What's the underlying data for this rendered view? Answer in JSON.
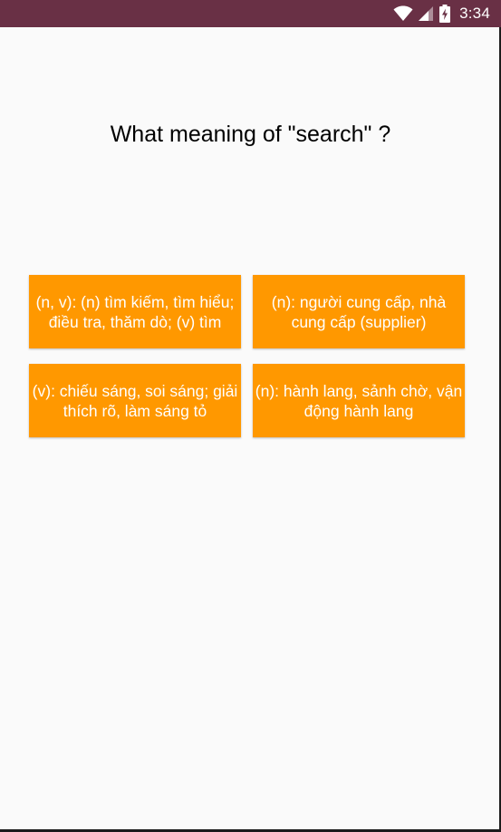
{
  "status_bar": {
    "time": "3:34",
    "background": "#693045",
    "icons": [
      "wifi-icon",
      "cellular-signal-icon",
      "battery-charging-icon"
    ]
  },
  "quiz": {
    "question": "What meaning of \"search\" ?",
    "answers": [
      {
        "label": "(n, v): (n) tìm kiếm, tìm hiểu; điều tra, thăm dò; (v) tìm"
      },
      {
        "label": "(n): người cung cấp, nhà cung cấp (supplier)"
      },
      {
        "label": "(v): chiếu sáng, soi sáng; giải thích rõ, làm sáng tỏ"
      },
      {
        "label": "(n): hành lang, sảnh chờ, vận động hành lang"
      }
    ],
    "answer_color": "#ff9800"
  }
}
